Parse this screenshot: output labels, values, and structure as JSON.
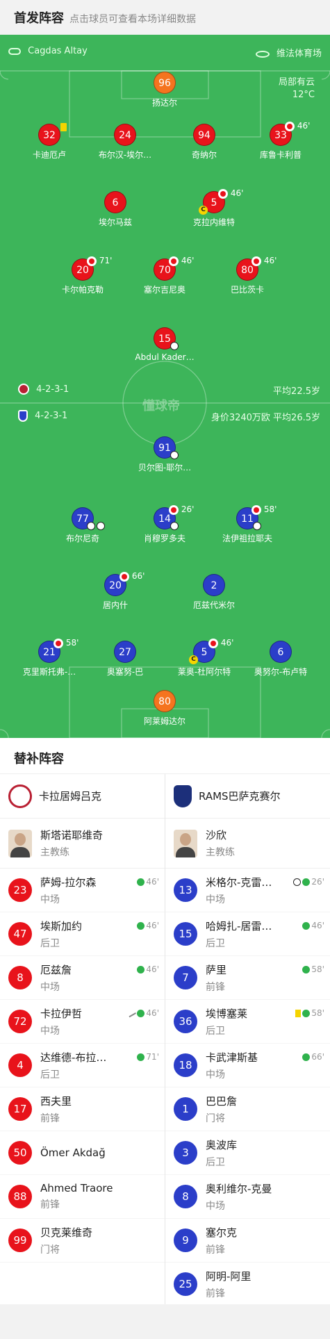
{
  "header": {
    "title": "首发阵容",
    "subtitle": "点击球员可查看本场详细数据"
  },
  "pitch": {
    "referee": "Cagdas Altay",
    "stadium": "维法体育场",
    "weather": "局部有云",
    "temperature": "12°C",
    "watermark": "懂球帝",
    "home": {
      "formation": "4-2-3-1",
      "avg_age": "平均22.5岁"
    },
    "away": {
      "formation": "4-2-3-1",
      "value_age": "身价3240万欧 平均26.5岁"
    },
    "home_players": [
      {
        "num": "96",
        "name": "扬达尔"
      },
      {
        "num": "32",
        "name": "卡迪厄卢"
      },
      {
        "num": "24",
        "name": "布尔汉-埃尔…"
      },
      {
        "num": "94",
        "name": "奇纳尔"
      },
      {
        "num": "33",
        "name": "库鲁卡利普",
        "sub": "46'"
      },
      {
        "num": "6",
        "name": "埃尔马兹"
      },
      {
        "num": "5",
        "name": "克拉内维特",
        "sub": "46'"
      },
      {
        "num": "20",
        "name": "卡尔帕克勒",
        "sub": "71'"
      },
      {
        "num": "70",
        "name": "塞尔吉尼奥",
        "sub": "46'"
      },
      {
        "num": "80",
        "name": "巴比茨卡",
        "sub": "46'"
      },
      {
        "num": "15",
        "name": "Abdul Kader…"
      }
    ],
    "away_players": [
      {
        "num": "91",
        "name": "贝尔图-耶尔…"
      },
      {
        "num": "77",
        "name": "布尔尼奇"
      },
      {
        "num": "14",
        "name": "肖穆罗多夫",
        "sub": "26'"
      },
      {
        "num": "11",
        "name": "法伊祖拉耶夫",
        "sub": "58'"
      },
      {
        "num": "20",
        "name": "居内什",
        "sub": "66'"
      },
      {
        "num": "2",
        "name": "厄兹代米尔"
      },
      {
        "num": "21",
        "name": "克里斯托弗-…",
        "sub": "58'"
      },
      {
        "num": "27",
        "name": "奥塞努-巴"
      },
      {
        "num": "5",
        "name": "莱奥-杜阿尔特",
        "sub": "46'"
      },
      {
        "num": "6",
        "name": "奥努尔-布卢特"
      },
      {
        "num": "80",
        "name": "阿莱姆达尔"
      }
    ]
  },
  "subs": {
    "title": "替补阵容",
    "home": {
      "team": "卡拉居姆吕克",
      "coach": {
        "name": "斯塔诺耶维奇",
        "role": "主教练"
      },
      "players": [
        {
          "num": "23",
          "name": "萨姆-拉尔森",
          "pos": "中场",
          "min": "46'"
        },
        {
          "num": "47",
          "name": "埃斯加约",
          "pos": "后卫",
          "min": "46'"
        },
        {
          "num": "8",
          "name": "厄兹詹",
          "pos": "中场",
          "min": "46'"
        },
        {
          "num": "72",
          "name": "卡拉伊哲",
          "pos": "中场",
          "min": "46'"
        },
        {
          "num": "4",
          "name": "达维德-布拉…",
          "pos": "后卫",
          "min": "71'"
        },
        {
          "num": "17",
          "name": "西夫里",
          "pos": "前锋",
          "min": ""
        },
        {
          "num": "50",
          "name": "Ömer Akdağ",
          "pos": "",
          "min": ""
        },
        {
          "num": "88",
          "name": "Ahmed Traore",
          "pos": "前锋",
          "min": ""
        },
        {
          "num": "99",
          "name": "贝克莱维奇",
          "pos": "门将",
          "min": ""
        }
      ]
    },
    "away": {
      "team": "RAMS巴萨克赛尔",
      "coach": {
        "name": "沙欣",
        "role": "主教练"
      },
      "players": [
        {
          "num": "13",
          "name": "米格尔-克雷…",
          "pos": "中场",
          "min": "26'"
        },
        {
          "num": "15",
          "name": "哈姆扎-居雷…",
          "pos": "后卫",
          "min": "46'"
        },
        {
          "num": "7",
          "name": "萨里",
          "pos": "前锋",
          "min": "58'"
        },
        {
          "num": "36",
          "name": "埃博塞莱",
          "pos": "后卫",
          "min": "58'"
        },
        {
          "num": "18",
          "name": "卡武津斯基",
          "pos": "中场",
          "min": "66'"
        },
        {
          "num": "1",
          "name": "巴巴詹",
          "pos": "门将",
          "min": ""
        },
        {
          "num": "3",
          "name": "奥波库",
          "pos": "后卫",
          "min": ""
        },
        {
          "num": "8",
          "name": "奥利维尔-克曼",
          "pos": "中场",
          "min": ""
        },
        {
          "num": "9",
          "name": "塞尔克",
          "pos": "前锋",
          "min": ""
        },
        {
          "num": "25",
          "name": "阿明-阿里",
          "pos": "前锋",
          "min": ""
        }
      ]
    }
  },
  "colors": {
    "pitch": "#3db55a",
    "home": "#e8131b",
    "away": "#2b3ec9",
    "keeper": "#f5741f"
  }
}
